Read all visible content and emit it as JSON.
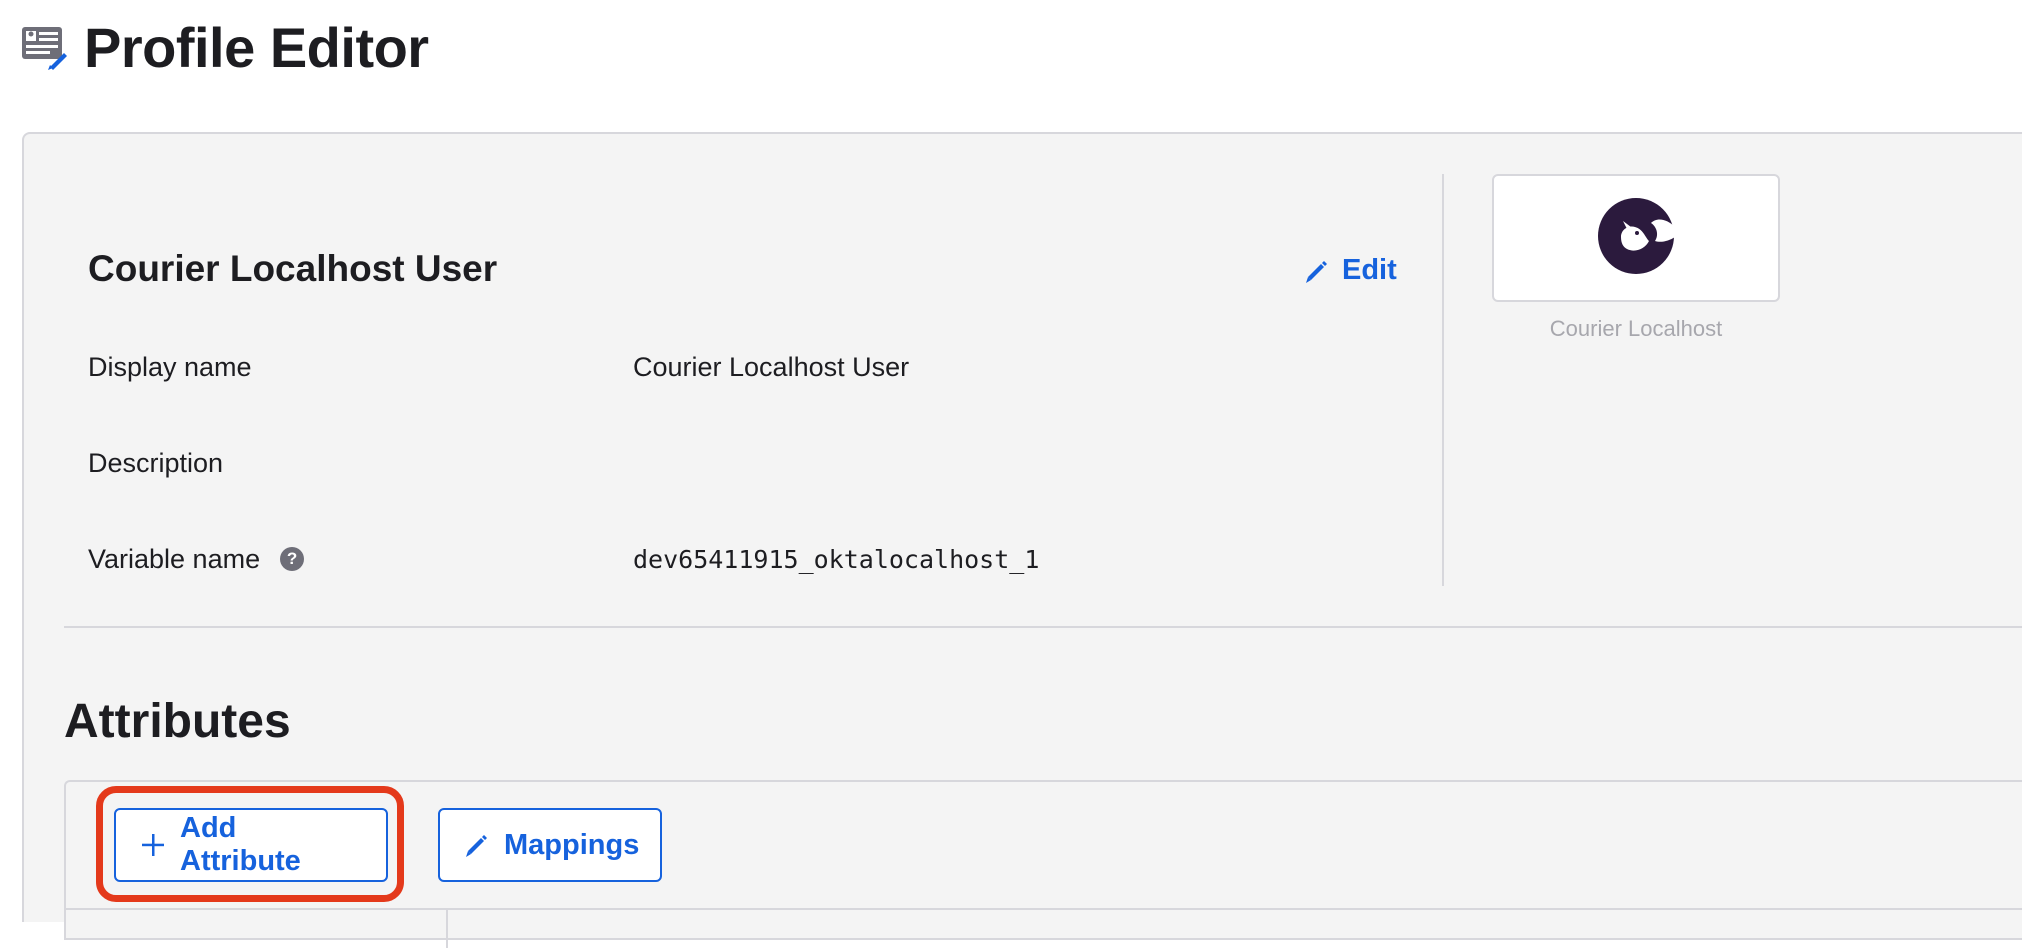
{
  "page": {
    "title": "Profile Editor",
    "icon": "profile-editor-icon"
  },
  "profile": {
    "title": "Courier Localhost User",
    "edit_label": "Edit",
    "fields": [
      {
        "label": "Display name",
        "value": "Courier Localhost User"
      },
      {
        "label": "Description",
        "value": ""
      },
      {
        "label": "Variable name",
        "value": "dev65411915_oktalocalhost_1",
        "help_icon": "question-icon"
      }
    ]
  },
  "app": {
    "name": "Courier Localhost",
    "logo_icon": "courier-bird-logo-icon",
    "logo_color": "#2b1a3d"
  },
  "attributes": {
    "title": "Attributes",
    "add_label": "Add Attribute",
    "mappings_label": "Mappings"
  },
  "colors": {
    "accent": "#1662dd",
    "highlight": "#e4391b",
    "panel_bg": "#f4f4f4",
    "border": "#d7d7dc"
  }
}
